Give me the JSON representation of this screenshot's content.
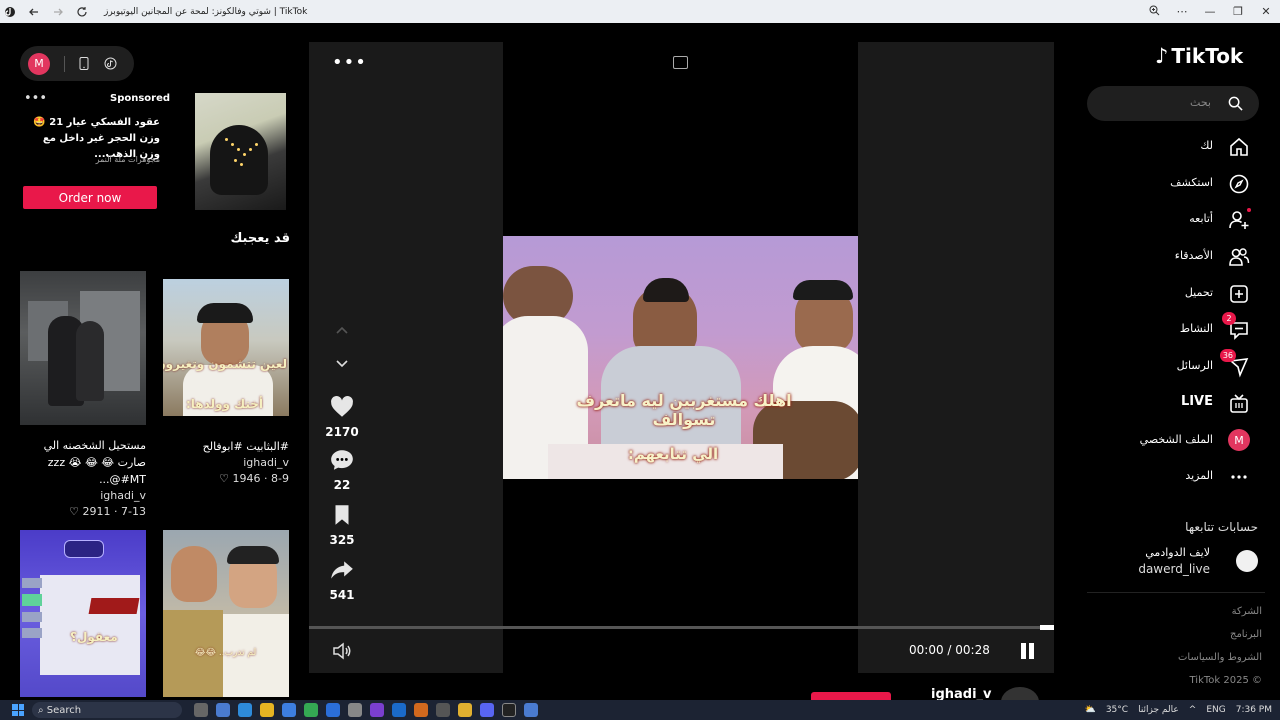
{
  "browser": {
    "tab_title": "شوتي وفالكونز: لمحة عن المجانين اليوتيوبرز | TikTok",
    "nav_icons": [
      "app-icon",
      "back-icon",
      "forward-icon",
      "reload-icon"
    ],
    "window_controls": [
      "zoom-icon",
      "more-icon",
      "minimize-icon",
      "maximize-icon",
      "close-icon"
    ]
  },
  "mode_switch": {
    "avatar_letter": "M",
    "icons": [
      "phone-icon",
      "tiktok-mode-icon"
    ]
  },
  "ad": {
    "sponsored_label": "Sponsored",
    "text": "عقود الفسكي عيار 21 🤩 وزن الحجر غير داخل مع وزن الذهب...",
    "brand": "مجوهرات ملة النمر",
    "cta": "Order now"
  },
  "recommend": {
    "heading": "قد يعجبك",
    "cards": [
      {
        "caption": "#البثابيت #ابوفالح",
        "author": "ighadi_v",
        "likes": "1946",
        "date": "8-9"
      },
      {
        "caption": "مستحيل الشخصنه الي صارت 😂 😂 😭 zzz #MT@...",
        "author": "ighadi_v",
        "likes": "2911",
        "date": "7-13"
      },
      {
        "caption": "",
        "author": "",
        "likes": "",
        "date": ""
      },
      {
        "caption": "",
        "author": "",
        "likes": "",
        "date": ""
      }
    ],
    "thumb_texts": [
      "لعين تتشمون وتغيرون",
      "أختك وولدها:",
      "معقول؟",
      "لم تدرب.. 😂😂"
    ]
  },
  "video": {
    "subtitle_1": "اهلك مستغربين ليه ماتعرف تسوالف",
    "subtitle_2": "الي تتابعهم:",
    "likes": "2170",
    "comments": "22",
    "saves": "325",
    "shares": "541",
    "time": "00:00 / 00:28",
    "progress": 0,
    "author": "ighadi_v"
  },
  "sidebar": {
    "brand": "TikTok",
    "search_placeholder": "بحث",
    "items": [
      {
        "label": "لك",
        "icon": "home-icon"
      },
      {
        "label": "استكشف",
        "icon": "compass-icon"
      },
      {
        "label": "أتابعه",
        "icon": "user-plus-icon"
      },
      {
        "label": "الأصدقاء",
        "icon": "friends-icon"
      },
      {
        "label": "تحميل",
        "icon": "upload-icon"
      },
      {
        "label": "النشاط",
        "icon": "activity-icon",
        "badge": "2"
      },
      {
        "label": "الرسائل",
        "icon": "messages-icon",
        "badge": "36"
      },
      {
        "label": "LIVE",
        "icon": "live-icon"
      },
      {
        "label": "الملف الشخصي",
        "icon": "profile-avatar",
        "avatar_letter": "M"
      },
      {
        "label": "المزيد",
        "icon": "more-icon"
      }
    ],
    "following_heading": "حسابات تتابعها",
    "following": [
      {
        "name": "لايف الدوادمي",
        "handle": "dawerd_live"
      }
    ],
    "footer": [
      "الشركة",
      "البرنامج",
      "الشروط والسياسات",
      "© TikTok 2025"
    ]
  },
  "taskbar": {
    "search": "Search",
    "weather": "35°C",
    "weather_label": "عالم جزائنا",
    "lang": "ENG",
    "time": "7:36 PM"
  },
  "colors": {
    "accent": "#e9184a",
    "avatar": "#e2365f",
    "bg": "#000000",
    "panel": "#1f1f1f"
  }
}
